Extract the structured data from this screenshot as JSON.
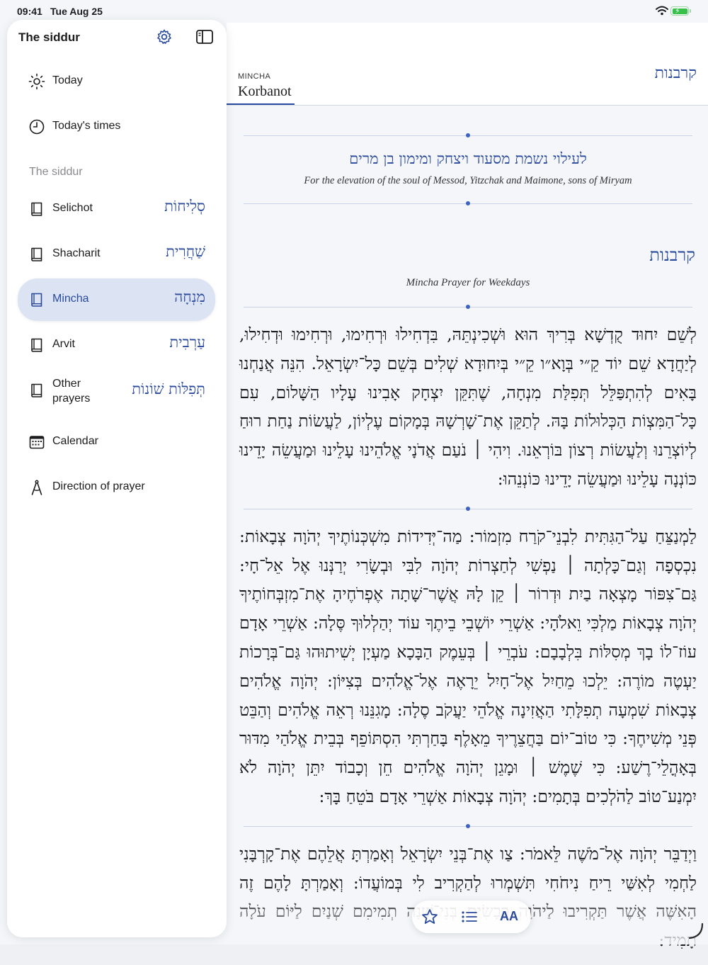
{
  "status": {
    "time": "09:41",
    "date": "Tue Aug 25"
  },
  "header": {
    "kicker": "MINCHA",
    "title": "Korbanot",
    "hebrew_title": "קרבנות"
  },
  "dedication": {
    "hebrew": "לעילוי נשמת מסעוד ויצחק ומימון בן מרים",
    "english": "For the elevation of the soul of Messod, Yitzchak and Maimone, sons of Miryam"
  },
  "section": {
    "hebrew": "קרבנות",
    "subtitle": "Mincha Prayer for Weekdays"
  },
  "paragraphs": [
    "לְשֵׁם יִחוּד קֻדְשָׁא בְּרִיךְ הוּא וּשְׁכִינְתֵּהּ, בִּדְחִילוּ וּרְחִימוּ, וּרְחִימוּ וּדְחִילוּ, לְיַחֲדָא שֵׁם יוֹד קֵ״י בְּוָא״ו קֵ״י בְּיִחוּדָא שְׁלִים בְּשֵׁם כָּל־יִשְׂרָאֵל. הִנֵּה אֲנַחְנוּ בָּאִים לְהִתְפַּלֵּל תְּפִלַּת מִנְחָה, שֶׁתִּקֵּן יִצְחָק אָבִינוּ עָלָיו הַשָּׁלוֹם, עִם כָּל־הַמִּצְוֹת הַכְּלוּלוֹת בָּהּ. לְתַקֵּן אֶת־שָׁרְשָׁהּ בְּמָקוֹם עֶלְיוֹן, לַעֲשׂוֹת נַחַת רוּחַ לְיוֹצְרֵנוּ וְלַעֲשׂוֹת רְצוֹן בּוֹרְאֵנוּ. וִיהִי ׀ נֹעַם אֲדֹנָי אֱלֹהֵינוּ עָלֵינוּ וּמַעֲשֵׂה יָדֵינוּ כּוֹנְנָה עָלֵינוּ וּמַעֲשֵׂה יָדֵינוּ כּוֹנְנֵהוּ:",
    "לַמְנַצֵּחַ עַל־הַגִּתִּית לִבְנֵי־קֹרַח מִזְמוֹר: מַה־יְּדִידוֹת מִשְׁכְּנוֹתֶיךָ יְהֹוָה צְבָאוֹת: נִכְסְפָה וְגַם־כָּלְתָה ׀ נַפְשִׁי לְחַצְרוֹת יְהֹוָה לִבִּי וּבְשָׂרִי יְרַנְּנוּ אֶל אֵל־חָי: גַּם־צִפּוֹר מָצְאָה בַיִת וּדְרוֹר ׀ קֵן לָהּ אֲשֶׁר־שָׁתָה אֶפְרֹחֶיהָ אֶת־מִזְבְּחוֹתֶיךָ יְהֹוָה צְבָאוֹת מַלְכִּי וֵאלֹהָי: אַשְׁרֵי יוֹשְׁבֵי בֵיתֶךָ עוֹד יְהַלְלוּךָ סֶּלָה: אַשְׁרֵי אָדָם עוֹז־לוֹ בָךְ מְסִלּוֹת בִּלְבָבָם: עֹבְרֵי ׀ בְּעֵמֶק הַבָּכָא מַעְיָן יְשִׁיתוּהוּ גַּם־בְּרָכוֹת יַעְטֶה מוֹרֶה: יֵלְכוּ מֵחַיִל אֶל־חָיִל יֵרָאֶה אֶל־אֱלֹהִים בְּצִיּוֹן: יְהֹוָה אֱלֹהִים צְבָאוֹת שִׁמְעָה תְפִלָּתִי הַאֲזִינָה אֱלֹהֵי יַעֲקֹב סֶלָה: מָגִנֵּנוּ רְאֵה אֱלֹהִים וְהַבֵּט פְּנֵי מְשִׁיחֶךָ: כִּי טוֹב־יוֹם בַּחֲצֵרֶיךָ מֵאָלֶף בָּחַרְתִּי הִסְתּוֹפֵף בְּבֵית אֱלֹהַי מִדּוּר בְּאָהֳלֵי־רֶשַׁע: כִּי שֶׁמֶשׁ ׀ וּמָגֵן יְהֹוָה אֱלֹהִים חֵן וְכָבוֹד יִתֵּן יְהֹוָה לֹא יִמְנַע־טוֹב לַהֹלְכִים בְּתָמִים: יְהֹוָה צְבָאוֹת אַשְׁרֵי אָדָם בֹּטֵחַ בָּךְ:",
    "וַיְדַבֵּר יְהֹוָה אֶל־מֹשֶׁה לֵּאמֹר: צַו אֶת־בְּנֵי יִשְׂרָאֵל וְאָמַרְתָּ אֲלֵהֶם אֶת־קָרְבָּנִי לַחְמִי לְאִשַּׁי רֵיחַ נִיחֹחִי תִּשְׁמְרוּ לְהַקְרִיב לִי בְּמוֹעֲדוֹ: וְאָמַרְתָּ לָהֶם זֶה הָאִשֶּׁה אֲשֶׁר תַּקְרִיבוּ לַיהֹוָה כְּבָשִׂים בְּנֵי־שָׁנָה תְמִימִם שְׁנַיִם לַיּוֹם עֹלָה תָמִיד:"
  ],
  "sidebar": {
    "title": "The siddur",
    "section_label": "The siddur",
    "items": [
      {
        "label": "Today",
        "icon": "sun-icon"
      },
      {
        "label": "Today's times",
        "icon": "clock-icon"
      },
      {
        "label": "Selichot",
        "hebrew": "סְלִיחוֹת",
        "icon": "book-icon"
      },
      {
        "label": "Shacharit",
        "hebrew": "שַׁחֲרִית",
        "icon": "book-icon"
      },
      {
        "label": "Mincha",
        "hebrew": "מִנְחָה",
        "icon": "book-icon",
        "selected": true
      },
      {
        "label": "Arvit",
        "hebrew": "עַרְבִית",
        "icon": "book-icon"
      },
      {
        "label": "Other prayers",
        "hebrew": "תְּפִלּוֹת שׁוֹנוֹת",
        "icon": "book-icon"
      },
      {
        "label": "Calendar",
        "icon": "calendar-icon"
      },
      {
        "label": "Direction of prayer",
        "icon": "compass-icon"
      }
    ]
  },
  "toolbar": {
    "text_size_label": "AA"
  },
  "colors": {
    "accent": "#2a4a9c",
    "selected_bg": "#dce3f3",
    "background": "#f4f6fa"
  }
}
